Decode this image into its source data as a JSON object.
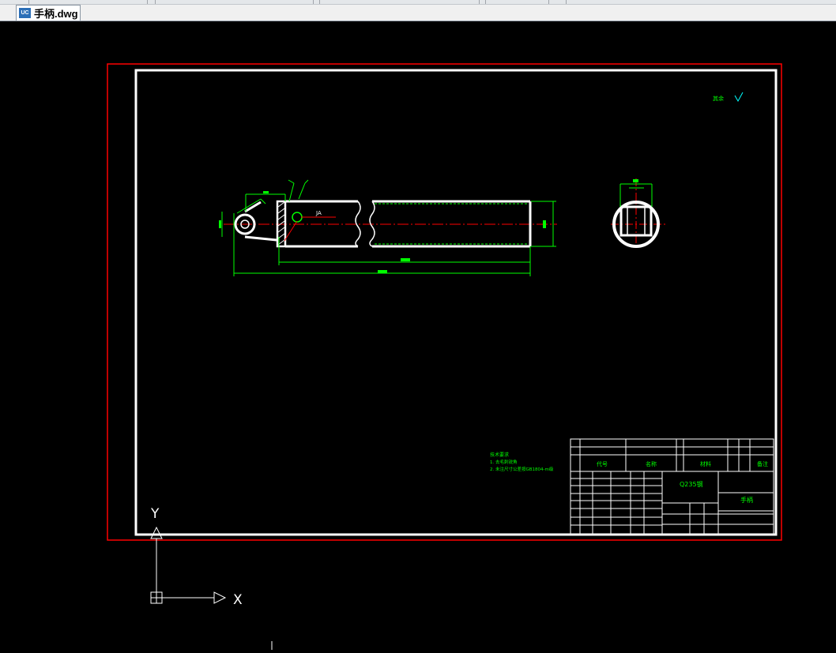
{
  "tab": {
    "file_name": "手柄.dwg",
    "icon": "dwg-file-icon",
    "icon_text": "UC"
  },
  "colors": {
    "background": "#000000",
    "frame": "#ffffff",
    "dimension": "#00ff00",
    "center_line": "#ff0000",
    "viewport": "#ff0000"
  },
  "drawing": {
    "roughness_note": "其余",
    "section_mark": "JA",
    "tech_requirements": [
      "技术要求",
      "1. 去毛刺锐角",
      "2. 未注尺寸公差按GB1804-m级"
    ],
    "title_block": {
      "material": "Q235钢",
      "part_name": "手柄",
      "col_code": "代号",
      "col_name": "名称",
      "col_material": "材料",
      "col_note": "备注"
    }
  },
  "ucs": {
    "x_label": "X",
    "y_label": "Y"
  }
}
